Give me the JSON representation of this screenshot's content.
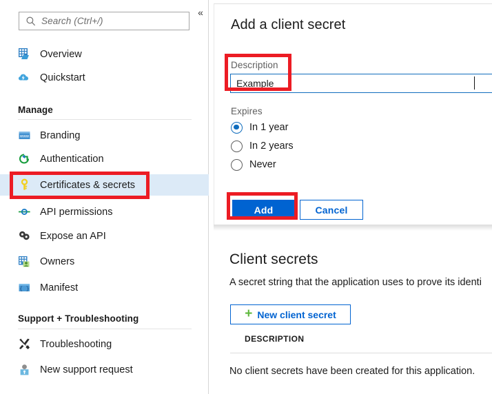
{
  "sidebar": {
    "search": {
      "placeholder": "Search (Ctrl+/)",
      "icon": "search-icon"
    },
    "collapse_label": "«",
    "items": [
      {
        "label": "Overview",
        "icon": "overview-grid-icon",
        "selected": false
      },
      {
        "label": "Quickstart",
        "icon": "quickstart-cloud-icon",
        "selected": false
      },
      {
        "label": "Branding",
        "icon": "branding-window-icon",
        "selected": false
      },
      {
        "label": "Authentication",
        "icon": "authentication-arrow-icon",
        "selected": false
      },
      {
        "label": "Certificates & secrets",
        "icon": "key-icon",
        "selected": true
      },
      {
        "label": "API permissions",
        "icon": "api-permissions-icon",
        "selected": false
      },
      {
        "label": "Expose an API",
        "icon": "expose-api-icon",
        "selected": false
      },
      {
        "label": "Owners",
        "icon": "owners-grid-person-icon",
        "selected": false
      },
      {
        "label": "Manifest",
        "icon": "manifest-braces-icon",
        "selected": false
      },
      {
        "label": "Troubleshooting",
        "icon": "wrench-screwdriver-icon",
        "selected": false
      },
      {
        "label": "New support request",
        "icon": "support-person-icon",
        "selected": false
      }
    ],
    "groups": [
      {
        "title": "Manage"
      },
      {
        "title": "Support + Troubleshooting"
      }
    ]
  },
  "dialog": {
    "title": "Add a client secret",
    "description_label": "Description",
    "description_value": "Example",
    "expires_label": "Expires",
    "expires_options": [
      {
        "label": "In 1 year",
        "selected": true
      },
      {
        "label": "In 2 years",
        "selected": false
      },
      {
        "label": "Never",
        "selected": false
      }
    ],
    "add_label": "Add",
    "cancel_label": "Cancel"
  },
  "page": {
    "section_title": "Client secrets",
    "section_desc": "A secret string that the application uses to prove its identi",
    "new_secret_label": "New client secret",
    "new_secret_plus": "+",
    "table_headers": [
      "DESCRIPTION"
    ],
    "empty_message": "No client secrets have been created for this application."
  },
  "colors": {
    "accent_blue": "#0063d1",
    "annotation_red": "#ec1c24",
    "selection_blue": "#dceaf7",
    "plus_green": "#5fb83d",
    "key_yellow": "#f0d12b"
  }
}
